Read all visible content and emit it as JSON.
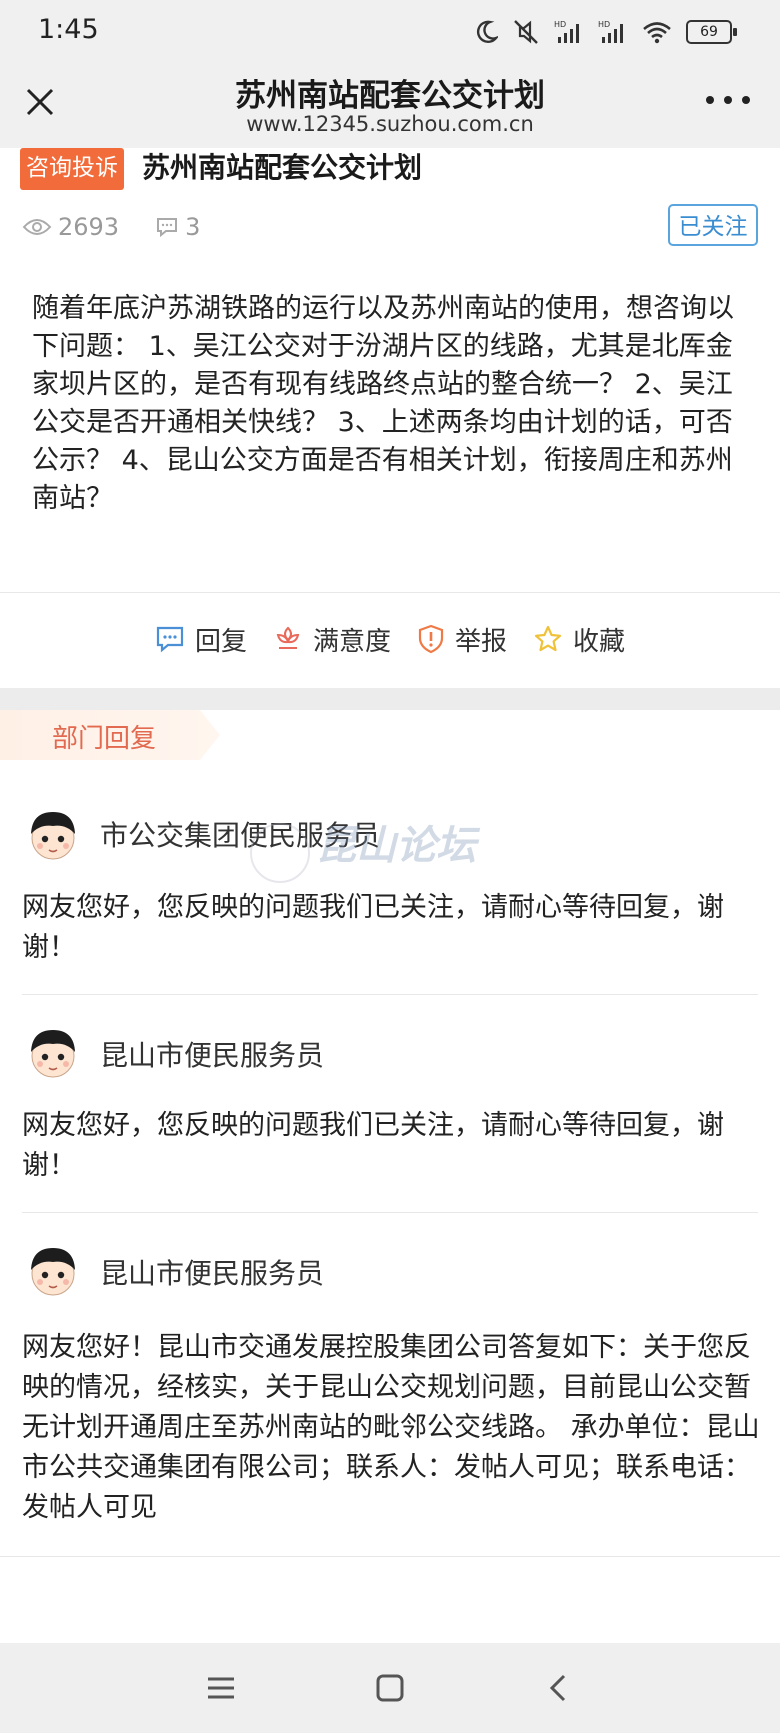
{
  "status_bar": {
    "time": "1:45",
    "battery": "69",
    "icons": [
      "moon-icon",
      "mute-icon",
      "signal-hd-icon",
      "signal-hd-icon",
      "wifi-icon",
      "battery-icon"
    ]
  },
  "app_bar": {
    "title": "苏州南站配套公交计划",
    "url": "www.12345.suzhou.com.cn"
  },
  "post": {
    "tag": "咨询投诉",
    "title": "苏州南站配套公交计划",
    "views": "2693",
    "comments": "3",
    "follow_label": "已关注",
    "body": "随着年底沪苏湖铁路的运行以及苏州南站的使用，想咨询以下问题： 1、吴江公交对于汾湖片区的线路，尤其是北厍金家坝片区的，是否有现有线路终点站的整合统一？ 2、吴江公交是否开通相关快线？ 3、上述两条均由计划的话，可否公示？ 4、昆山公交方面是否有相关计划，衔接周庄和苏州南站？"
  },
  "actions": {
    "reply": "回复",
    "satisfaction": "满意度",
    "report": "举报",
    "favorite": "收藏"
  },
  "dept_reply": {
    "tab_label": "部门回复",
    "replies": [
      {
        "name": "市公交集团便民服务员",
        "text": "网友您好，您反映的问题我们已关注，请耐心等待回复，谢谢！"
      },
      {
        "name": "昆山市便民服务员",
        "text": "网友您好，您反映的问题我们已关注，请耐心等待回复，谢谢！"
      },
      {
        "name": "昆山市便民服务员",
        "text": "网友您好！昆山市交通发展控股集团公司答复如下：关于您反映的情况，经核实，关于昆山公交规划问题，目前昆山公交暂无计划开通周庄至苏州南站的毗邻公交线路。 承办单位：昆山市公共交通集团有限公司；联系人：发帖人可见；联系电话：发帖人可见"
      }
    ]
  },
  "watermark": {
    "text": "昆山论坛"
  },
  "colors": {
    "tag_bg": "#f26b3a",
    "follow_border": "#5ba5de",
    "dept_tab_text": "#e26a50"
  }
}
